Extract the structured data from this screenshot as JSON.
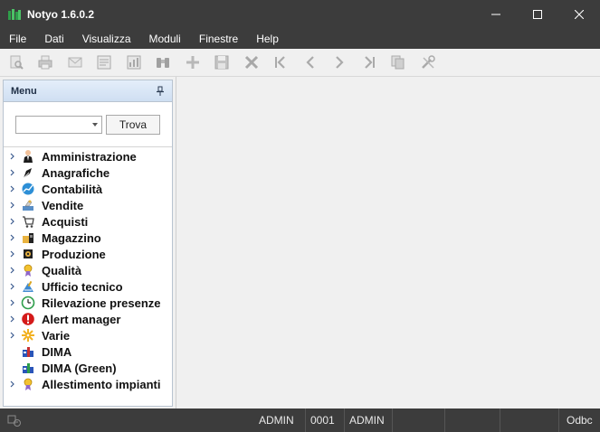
{
  "window": {
    "title": "Notyo 1.6.0.2",
    "minimize_icon": "minimize-icon",
    "maximize_icon": "maximize-icon",
    "close_icon": "close-icon"
  },
  "menubar": {
    "items": [
      "File",
      "Dati",
      "Visualizza",
      "Moduli",
      "Finestre",
      "Help"
    ]
  },
  "toolbar": {
    "buttons": [
      "preview-icon",
      "print-icon",
      "email-icon",
      "form-icon",
      "report-icon",
      "binoculars-icon",
      "new-icon",
      "save-icon",
      "delete-icon",
      "first-icon",
      "previous-icon",
      "next-icon",
      "last-icon",
      "copy-icon",
      "tools-icon"
    ],
    "state": "disabled"
  },
  "menu_panel": {
    "title": "Menu",
    "search": {
      "value": "",
      "button_label": "Trova"
    },
    "items": [
      {
        "label": "Amministrazione",
        "icon": "administrator-icon",
        "expandable": true
      },
      {
        "label": "Anagrafiche",
        "icon": "pen-icon",
        "expandable": true
      },
      {
        "label": "Contabilità",
        "icon": "chart-globe-icon",
        "expandable": true
      },
      {
        "label": "Vendite",
        "icon": "sales-icon",
        "expandable": true
      },
      {
        "label": "Acquisti",
        "icon": "cart-icon",
        "expandable": true
      },
      {
        "label": "Magazzino",
        "icon": "warehouse-icon",
        "expandable": true
      },
      {
        "label": "Produzione",
        "icon": "production-icon",
        "expandable": true
      },
      {
        "label": "Qualità",
        "icon": "quality-medal-icon",
        "expandable": true
      },
      {
        "label": "Ufficio tecnico",
        "icon": "technical-office-icon",
        "expandable": true
      },
      {
        "label": "Rilevazione presenze",
        "icon": "clock-icon",
        "expandable": true
      },
      {
        "label": "Alert manager",
        "icon": "alert-icon",
        "expandable": true
      },
      {
        "label": "Varie",
        "icon": "misc-gear-icon",
        "expandable": true
      },
      {
        "label": "DIMA",
        "icon": "dima-icon",
        "expandable": false
      },
      {
        "label": "DIMA (Green)",
        "icon": "dima-green-icon",
        "expandable": false
      },
      {
        "label": "Allestimento impianti",
        "icon": "quality-medal-icon",
        "expandable": true
      }
    ]
  },
  "statusbar": {
    "icon": "connection-status-icon",
    "user": "ADMIN",
    "company_code": "0001",
    "operator": "ADMIN",
    "connection": "Odbc"
  }
}
